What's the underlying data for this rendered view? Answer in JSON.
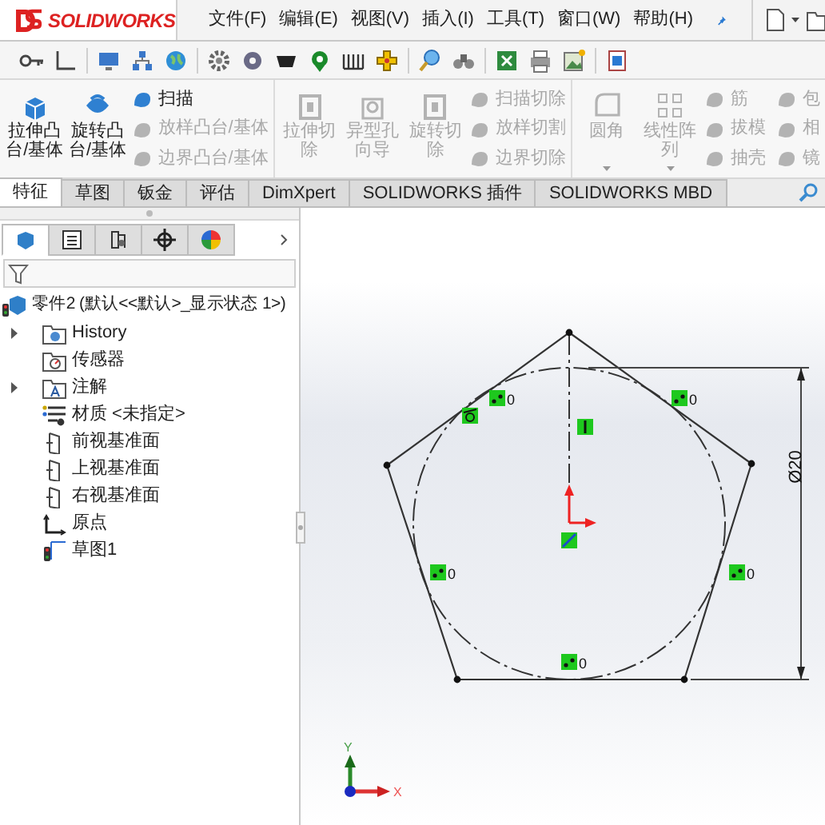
{
  "app": {
    "logo": "SOLIDWORKS"
  },
  "menu": [
    {
      "label": "文件(F)"
    },
    {
      "label": "编辑(E)"
    },
    {
      "label": "视图(V)"
    },
    {
      "label": "插入(I)"
    },
    {
      "label": "工具(T)"
    },
    {
      "label": "窗口(W)"
    },
    {
      "label": "帮助(H)"
    }
  ],
  "command_groups": [
    {
      "large": [
        {
          "label": "拉伸凸台/基体",
          "disabled": false
        },
        {
          "label": "旋转凸台/基体",
          "disabled": false
        }
      ],
      "small": [
        {
          "label": "扫描",
          "disabled": false
        },
        {
          "label": "放样凸台/基体",
          "disabled": true
        },
        {
          "label": "边界凸台/基体",
          "disabled": true
        }
      ]
    },
    {
      "large": [
        {
          "label": "拉伸切除",
          "disabled": true
        },
        {
          "label": "异型孔向导",
          "disabled": true
        },
        {
          "label": "旋转切除",
          "disabled": true
        }
      ],
      "small": [
        {
          "label": "扫描切除",
          "disabled": true
        },
        {
          "label": "放样切割",
          "disabled": true
        },
        {
          "label": "边界切除",
          "disabled": true
        }
      ]
    },
    {
      "large": [
        {
          "label": "圆角",
          "disabled": true,
          "dropdown": true
        },
        {
          "label": "线性阵列",
          "disabled": true,
          "dropdown": true
        }
      ],
      "small": [
        {
          "label": "筋",
          "disabled": true
        },
        {
          "label": "拔模",
          "disabled": true
        },
        {
          "label": "抽壳",
          "disabled": true
        }
      ],
      "small_2": [
        {
          "label": "包",
          "disabled": true
        },
        {
          "label": "相",
          "disabled": true
        },
        {
          "label": "镜",
          "disabled": true
        }
      ]
    }
  ],
  "tabs": [
    {
      "label": "特征",
      "selected": true
    },
    {
      "label": "草图",
      "selected": false
    },
    {
      "label": "钣金",
      "selected": false
    },
    {
      "label": "评估",
      "selected": false
    },
    {
      "label": "DimXpert",
      "selected": false
    },
    {
      "label": "SOLIDWORKS 插件",
      "selected": false
    },
    {
      "label": "SOLIDWORKS MBD",
      "selected": false
    }
  ],
  "panel_tabs": [
    {
      "kind": "tree",
      "selected": true
    },
    {
      "kind": "property",
      "selected": false
    },
    {
      "kind": "config",
      "selected": false
    },
    {
      "kind": "dimxpert",
      "selected": false
    },
    {
      "kind": "display",
      "selected": false
    }
  ],
  "tree": {
    "label": "零件2 (默认<<默认>_显示状态 1>)",
    "children": [
      {
        "kind": "history",
        "label": "History",
        "expanded": false
      },
      {
        "kind": "sensor",
        "label": "传感器"
      },
      {
        "kind": "annotation",
        "label": "注解",
        "expanded": false
      },
      {
        "kind": "material",
        "label": "材质 <未指定>"
      },
      {
        "kind": "plane",
        "label": "前视基准面"
      },
      {
        "kind": "plane",
        "label": "上视基准面"
      },
      {
        "kind": "plane",
        "label": "右视基准面"
      },
      {
        "kind": "origin",
        "label": "原点"
      },
      {
        "kind": "sketch",
        "label": "草图1"
      }
    ]
  },
  "sketch": {
    "dimension": "Ø20",
    "relations": [
      {
        "kind": "coincident",
        "label": "0"
      },
      {
        "kind": "coincident",
        "label": "0"
      },
      {
        "kind": "tangent"
      },
      {
        "kind": "vertical"
      },
      {
        "kind": "origin"
      },
      {
        "kind": "coincident",
        "label": "0"
      },
      {
        "kind": "coincident",
        "label": "0"
      },
      {
        "kind": "coincident",
        "label": "0"
      }
    ]
  },
  "triad": {
    "y": "Y",
    "x": "X"
  }
}
